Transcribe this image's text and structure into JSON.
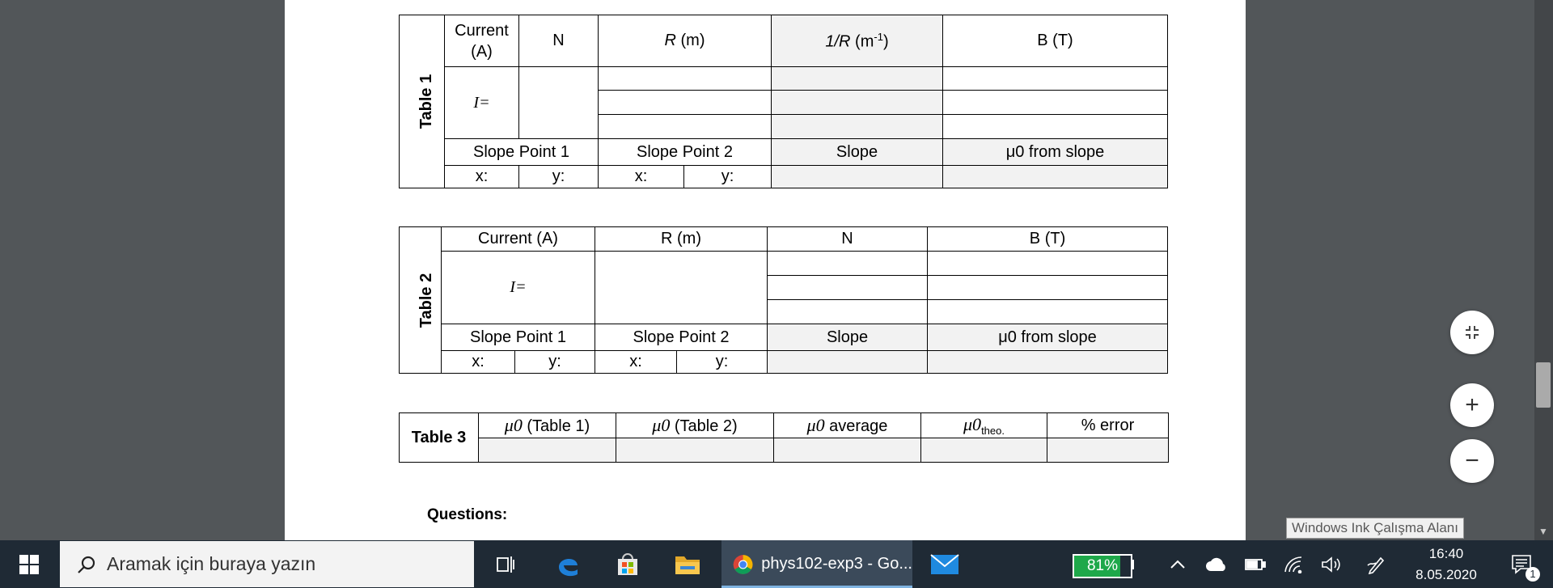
{
  "document": {
    "table1": {
      "label": "Table 1",
      "headers": {
        "current": "Current (A)",
        "n": "N",
        "r_var": "R",
        "r_unit": " (m)",
        "inv_r_var": "1/R",
        "inv_r_unit": " (m",
        "inv_r_exp": "-1",
        "inv_r_close": ")",
        "b": "B (T)"
      },
      "i_label": "I=",
      "slope_point_1": "Slope Point 1",
      "slope_point_2": "Slope Point 2",
      "slope": "Slope",
      "mu0_from_slope": "μ0 from slope",
      "x_label": "x:",
      "y_label": "y:"
    },
    "table2": {
      "label": "Table 2",
      "headers": {
        "current": "Current (A)",
        "r": "R (m)",
        "n": "N",
        "b": "B (T)"
      },
      "i_label": "I=",
      "slope_point_1": "Slope Point 1",
      "slope_point_2": "Slope Point 2",
      "slope": "Slope",
      "mu0_from_slope": "μ0 from slope",
      "x_label": "x:",
      "y_label": "y:"
    },
    "table3": {
      "label": "Table 3",
      "mu": "μ0",
      "col1": "(Table 1)",
      "col2": "(Table 2)",
      "col3": " average",
      "col4": "theo.",
      "col5": "% error"
    },
    "questions_label": "Questions:"
  },
  "viewer": {
    "fit_icon": "collapse-arrows-icon",
    "zoom_in": "+",
    "zoom_out": "−",
    "ink_tooltip": "Windows Ink Çalışma Alanı"
  },
  "taskbar": {
    "search_placeholder": "Aramak için buraya yazın",
    "active_app_label": "phys102-exp3 - Go...",
    "battery_percent": "81%",
    "battery_level": 0.81,
    "time": "16:40",
    "date": "8.05.2020",
    "notification_count": "1",
    "accent_color": "#1ea84a"
  }
}
